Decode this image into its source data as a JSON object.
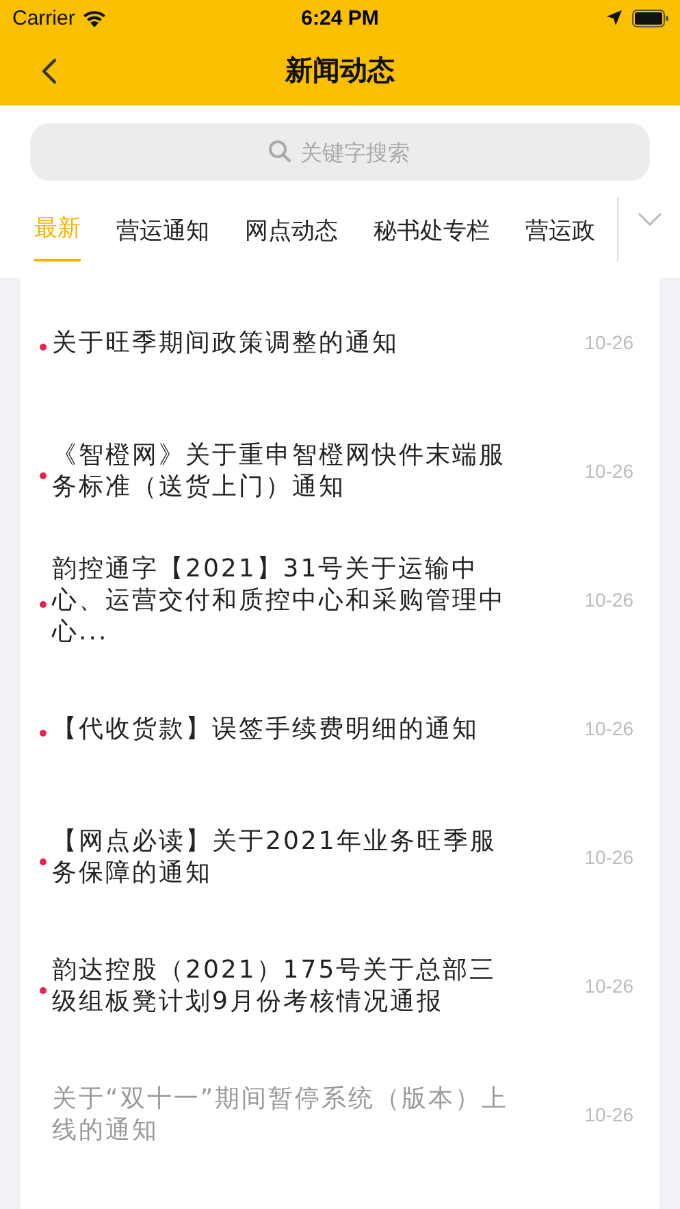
{
  "status_bar": {
    "carrier": "Carrier",
    "time": "6:24 PM"
  },
  "nav_bar": {
    "title": "新闻动态"
  },
  "search": {
    "placeholder": "关键字搜索"
  },
  "tabs": [
    {
      "label": "最新",
      "selected": true
    },
    {
      "label": "营运通知",
      "selected": false
    },
    {
      "label": "网点动态",
      "selected": false
    },
    {
      "label": "秘书处专栏",
      "selected": false
    },
    {
      "label": "营运政",
      "selected": false
    }
  ],
  "news": [
    {
      "title": "关于旺季期间政策调整的通知",
      "date": "10-26",
      "unread": true
    },
    {
      "title": "《智橙网》关于重申智橙网快件末端服务标准（送货上门）通知",
      "date": "10-26",
      "unread": true
    },
    {
      "title": "韵控通字【2021】31号关于运输中心、运营交付和质控中心和采购管理中心...",
      "date": "10-26",
      "unread": true
    },
    {
      "title": "【代收货款】误签手续费明细的通知",
      "date": "10-26",
      "unread": true
    },
    {
      "title": "【网点必读】关于2021年业务旺季服务保障的通知",
      "date": "10-26",
      "unread": true
    },
    {
      "title": "韵达控股（2021）175号关于总部三级组板凳计划9月份考核情况通报",
      "date": "10-26",
      "unread": true
    },
    {
      "title": "关于“双十一”期间暂停系统（版本）上线的通知",
      "date": "10-26",
      "unread": false
    }
  ]
}
